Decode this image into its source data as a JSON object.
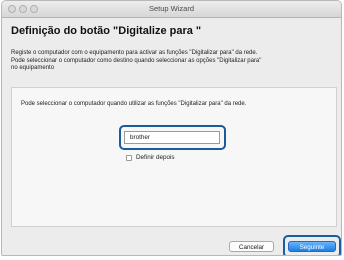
{
  "window": {
    "title": "Setup Wizard"
  },
  "page": {
    "heading": "Definição do botão \"Digitalize para \"",
    "description_line1": "Registe o computador com o equipamento para activar as funções \"Digitalizar para\" da rede.",
    "description_line2": "Pode seleccionar o computador como destino quando seleccionar as opções \"Digitalizar para\"",
    "description_line3": "no equipamento"
  },
  "panel": {
    "text": "Pode seleccionar o computador quando utilizar as funções \"Digitalizar para\" da rede.",
    "name_value": "brother",
    "checkbox_label": "Definir depois",
    "checkbox_checked": false
  },
  "buttons": {
    "cancel": "Cancelar",
    "next": "Seguinte"
  },
  "colors": {
    "callout": "#1d5b9d",
    "primary_button": "#1b7fe6"
  }
}
